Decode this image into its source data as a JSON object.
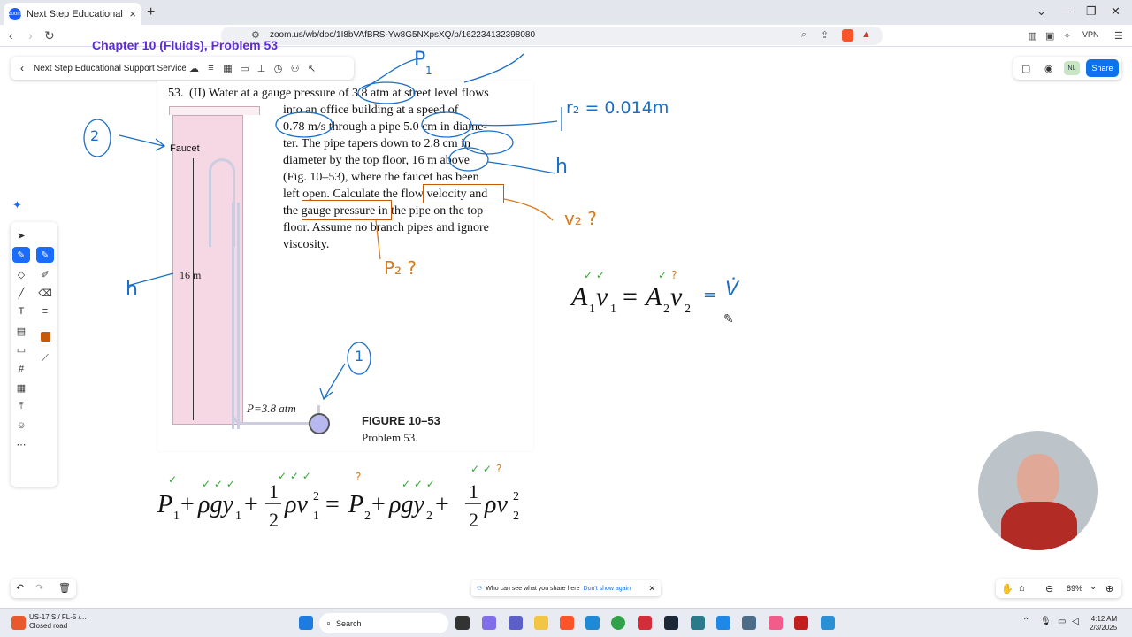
{
  "browser": {
    "tab_title": "Next Step Educational Support",
    "url": "zoom.us/wb/doc/1I8bVAfBRS-Yw8G5NXpsXQ/p/162234132398080",
    "vpn": "VPN",
    "fav_text": "zoom"
  },
  "whiteboard": {
    "doc_title": "Next Step Educational Support Services LL...",
    "share_label": "Share",
    "user_initials": "NL",
    "zoom_level": "89%",
    "heading_partial": "Chapter 10 (Fluids), Problem 53"
  },
  "banner": {
    "text": "Who can see what you share here",
    "link": "Don't show again"
  },
  "problem": {
    "number": "53.",
    "lines": [
      "(II) Water at a gauge pressure of 3.8 atm at street level flows",
      "into an office building at a speed of",
      "0.78 m/s through a pipe 5.0 cm in diame-",
      "ter. The pipe tapers down to 2.8 cm in",
      "diameter by the top floor, 16 m above",
      "(Fig. 10–53), where the faucet has been",
      "left open. Calculate the flow velocity and",
      "the gauge pressure in the pipe on the top",
      "floor. Assume no branch pipes and ignore",
      "viscosity."
    ],
    "faucet_label": "Faucet",
    "height_label": "16 m",
    "pressure_label": "P=3.8 atm",
    "figure_title": "FIGURE 10–53",
    "figure_caption": "Problem 53."
  },
  "handwriting": {
    "p1": "P",
    "p1_sub": "1",
    "r2": "r₂ = 0.014m",
    "h_right": "h",
    "v2q": "v₂ ?",
    "p2q": "P₂ ?",
    "h_left": "h",
    "circle1": "1",
    "circle2": "2",
    "vdot": "V̇"
  },
  "taskbar": {
    "search": "Search",
    "weather_line1": "US-17 S / FL-5 /...",
    "weather_line2": "Closed road",
    "time": "4:12 AM",
    "date": "2/3/2025"
  }
}
